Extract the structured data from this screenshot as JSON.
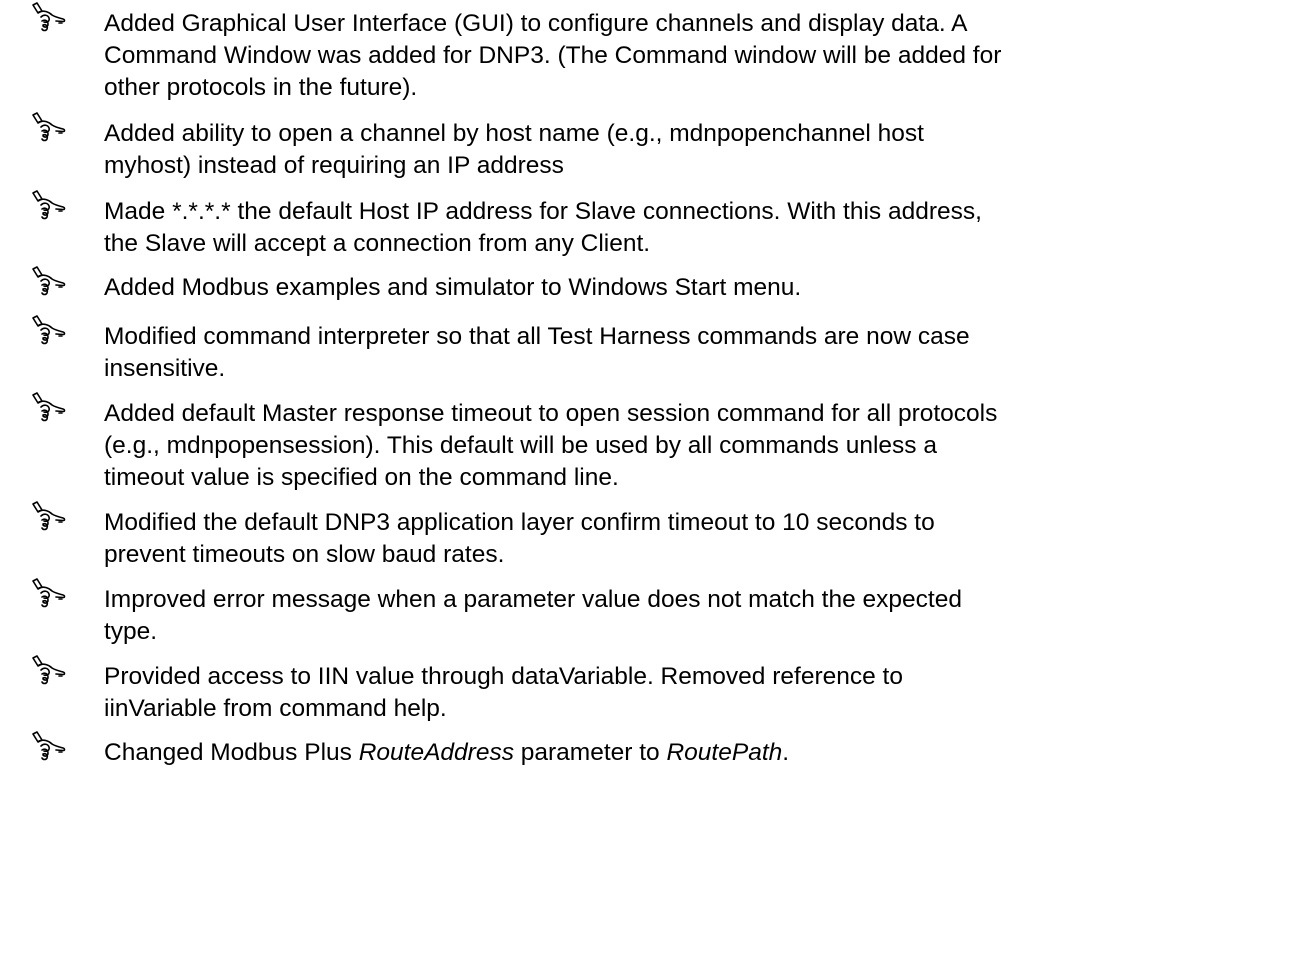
{
  "items": [
    {
      "icon": "pointing-hand-icon",
      "text": "Added Graphical User Interface (GUI) to configure channels and display data. A\nCommand Window was added for DNP3. (The Command window will be added for\nother protocols in the future)."
    },
    {
      "icon": "pointing-hand-icon",
      "text": "Added ability to open a channel by host name (e.g., mdnpopenchannel host\nmyhost) instead of requiring an IP address"
    },
    {
      "icon": "pointing-hand-icon",
      "text": "Made *.*.*.* the default Host IP address for Slave connections. With this address,\nthe Slave will accept a connection from any Client."
    },
    {
      "icon": "pointing-hand-icon",
      "text": "Added Modbus examples and simulator to Windows Start menu."
    },
    {
      "icon": "pointing-hand-icon",
      "text": "Modified command interpreter so that all Test Harness commands are now case\ninsensitive."
    },
    {
      "icon": "pointing-hand-icon",
      "text": "Added default Master response timeout to open session command for all protocols\n(e.g., mdnpopensession). This default will be used by all commands unless a\ntimeout value is specified on the command line."
    },
    {
      "icon": "pointing-hand-icon",
      "text": "Modified the default DNP3 application layer confirm timeout to 10 seconds to\nprevent timeouts on slow baud rates."
    },
    {
      "icon": "pointing-hand-icon",
      "text": "Improved error message when a parameter value does not match the expected\ntype."
    },
    {
      "icon": "pointing-hand-icon",
      "text": "Provided access to IIN value through dataVariable. Removed reference to\niinVariable from command help."
    },
    {
      "icon": "pointing-hand-icon",
      "text_parts": [
        "Changed Modbus Plus ",
        "RouteAddress",
        " parameter to ",
        "RoutePath",
        "."
      ]
    }
  ]
}
